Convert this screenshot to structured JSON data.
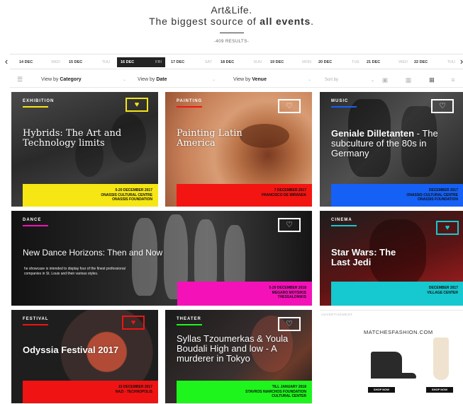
{
  "header": {
    "brand": "Art&Life.",
    "tagline_pre": "The biggest source of ",
    "tagline_bold": "all events",
    "tagline_post": ".",
    "results": "-409 RESULTS-"
  },
  "datebar": {
    "prev_icon": "chevron-left-icon",
    "next_icon": "chevron-right-icon",
    "dates": [
      {
        "date": "14 DEC",
        "dow": "WED"
      },
      {
        "date": "15 DEC",
        "dow": "THU"
      },
      {
        "date": "16 DEC",
        "dow": "FRI",
        "active": true
      },
      {
        "date": "17 DEC",
        "dow": "SAT"
      },
      {
        "date": "18 DEC",
        "dow": "SUN"
      },
      {
        "date": "19 DEC",
        "dow": "MON"
      },
      {
        "date": "20 DEC",
        "dow": "TUE"
      },
      {
        "date": "21 DEC",
        "dow": "WED"
      },
      {
        "date": "22 DEC",
        "dow": "THU"
      }
    ]
  },
  "filters": {
    "category_pre": "View by ",
    "category_bold": "Category",
    "date_pre": "View by ",
    "date_bold": "Date",
    "venue_pre": "View by ",
    "venue_bold": "Venue",
    "sort": "Sort by",
    "icons": [
      "sliders-icon",
      "list-view-icon",
      "compact-view-icon",
      "grid-view-icon",
      "menu-view-icon"
    ]
  },
  "events": {
    "exhibition": {
      "category": "EXHIBITION",
      "title": "Hybrids: The Art and Technology limits",
      "date": "5-20 DECEMBER 2017",
      "venue1": "ONASSIS CULTURAL CENTRE",
      "venue2": "ONASSIS FOUNDATION",
      "accent": "#f5e614"
    },
    "painting": {
      "category": "PAINTING",
      "title": "Painting Latin America",
      "date": "7 DECEMBER 2017",
      "venue1": "FRANCISCO DE MIRANDA",
      "accent": "#f31512"
    },
    "music": {
      "category": "MUSIC",
      "title_bold": "Geniale Dilletanten",
      "title_rest": " - The subculture of the 80s in Germany",
      "date": "DECEMBER 2017",
      "venue1": "ONASSIS CULTURAL CENTRE",
      "venue2": "ONASSIS FOUNDATION",
      "accent": "#1560f5"
    },
    "dance": {
      "category": "DANCE",
      "title": "New Dance Horizons: Then and Now",
      "description": "he showcase is intended to display four of the finest professional companies in St. Louis and their various styles.",
      "date": "5-20 DECEMBER 2018",
      "venue1": "MEGARO MOYSIKIS",
      "venue2": "THESSALONIKIS",
      "accent": "#f511b8"
    },
    "cinema": {
      "category": "CINEMA",
      "title": "Star Wars: The Last Jedi",
      "date": "DECEMBER 2017",
      "venue1": "VILLAGE CENTER",
      "accent": "#16c8cf"
    },
    "festival": {
      "category": "FESTIVAL",
      "title": "Odyssia Festival 2017",
      "date": "15 DECEMBER 2017",
      "venue1": "NAZI - TECHNOPOLIS",
      "accent": "#ef1313"
    },
    "theater": {
      "category": "THEATER",
      "title": "Syllas Tzoumerkas & Youla Boudali High and low - A murderer in Tokyo",
      "date": "TILL JANUARY 2018",
      "venue1": "STAVROS NIARCHOS FOUNDATION",
      "venue2": "CULTURAL CENTER",
      "accent": "#1ef51c"
    }
  },
  "advert": {
    "label": "ADVERTISEMENT",
    "brand": "MATCHESFASHION.COM",
    "cta": "SHOP NOW"
  }
}
